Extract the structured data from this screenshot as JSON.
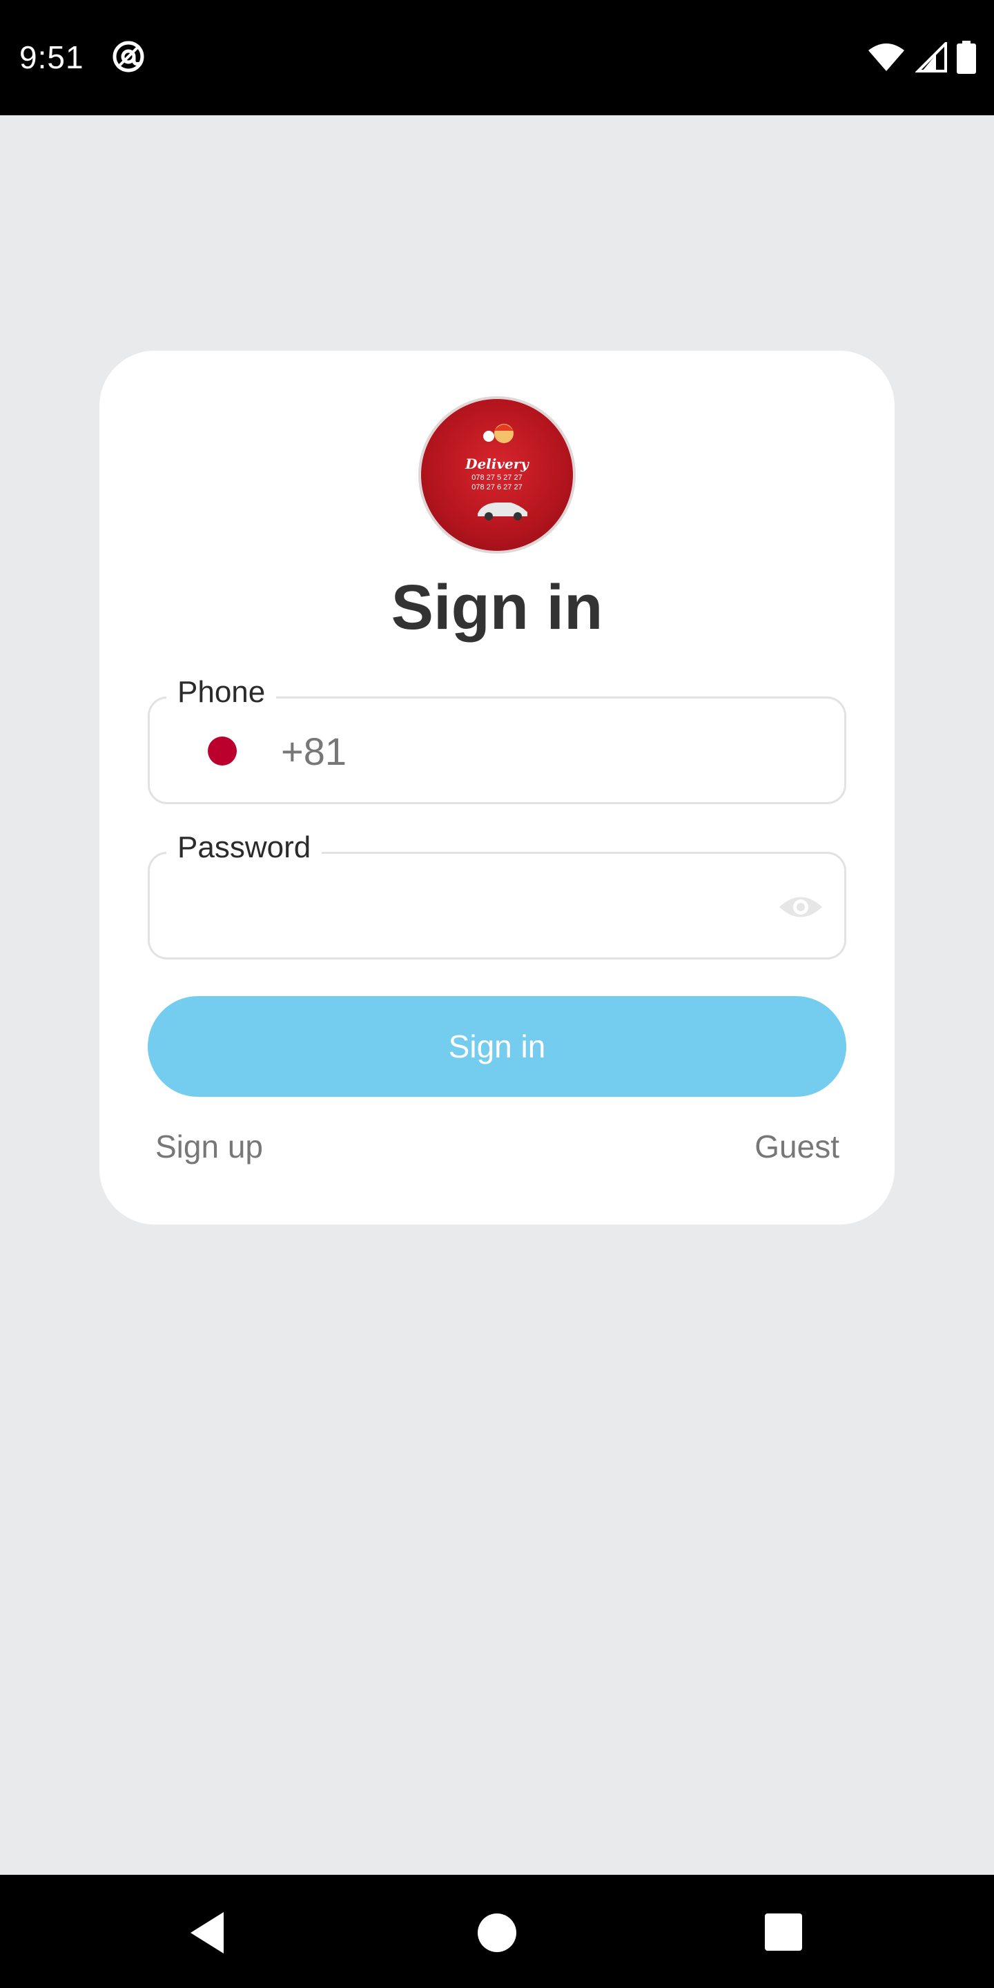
{
  "status_bar": {
    "time": "9:51",
    "icons": [
      "sync-at-icon",
      "wifi-icon",
      "cell-signal-icon",
      "battery-icon"
    ]
  },
  "card": {
    "logo": {
      "title": "Delivery",
      "phone_1": "078 27 5 27 27",
      "phone_2": "078 27 6 27 27"
    },
    "title": "Sign in",
    "phone_field": {
      "label": "Phone",
      "country_flag": "japan-flag-icon",
      "code": "+81",
      "value": ""
    },
    "password_field": {
      "label": "Password",
      "value": "",
      "visibility_icon": "eye-icon"
    },
    "signin_button": "Sign in",
    "signup_link": "Sign up",
    "guest_link": "Guest"
  },
  "colors": {
    "background": "#e9eaec",
    "card": "#ffffff",
    "button": "#74ccee",
    "flag_red": "#bc002d"
  },
  "nav_bar": {
    "icons": [
      "back-icon",
      "home-icon",
      "recents-icon"
    ]
  }
}
